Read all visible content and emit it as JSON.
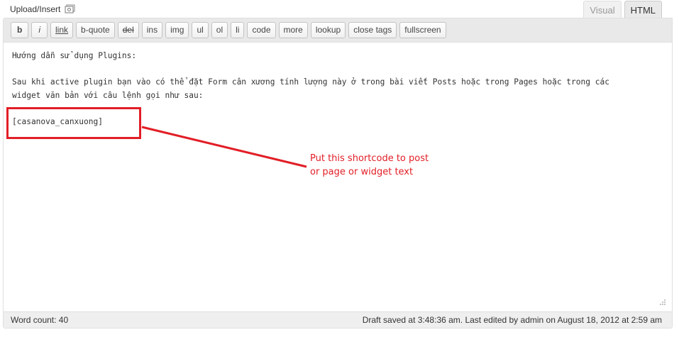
{
  "upload": {
    "label": "Upload/Insert",
    "icon": "media-library-icon"
  },
  "tabs": {
    "visual": "Visual",
    "html": "HTML"
  },
  "quicktags": [
    "b",
    "i",
    "link",
    "b-quote",
    "del",
    "ins",
    "img",
    "ul",
    "ol",
    "li",
    "code",
    "more",
    "lookup",
    "close tags",
    "fullscreen"
  ],
  "content": {
    "line1": "Hướng dẫn sử dụng Plugins:",
    "line2": "Sau khi active plugin bạn vào có thể đặt Form cân xương tính lượng này ở trong bài viết Posts hoặc trong Pages hoặc trong các",
    "line3": "widget văn bản với câu lệnh gọi như sau:",
    "shortcode": "[casanova_canxuong]"
  },
  "annotation": {
    "line1": "Put this shortcode to post",
    "line2": "or page or widget text",
    "color": "#e21e26"
  },
  "status": {
    "word_count": "Word count: 40",
    "draft": "Draft saved at 3:48:36 am. Last edited by admin on August 18, 2012 at 2:59 am"
  }
}
